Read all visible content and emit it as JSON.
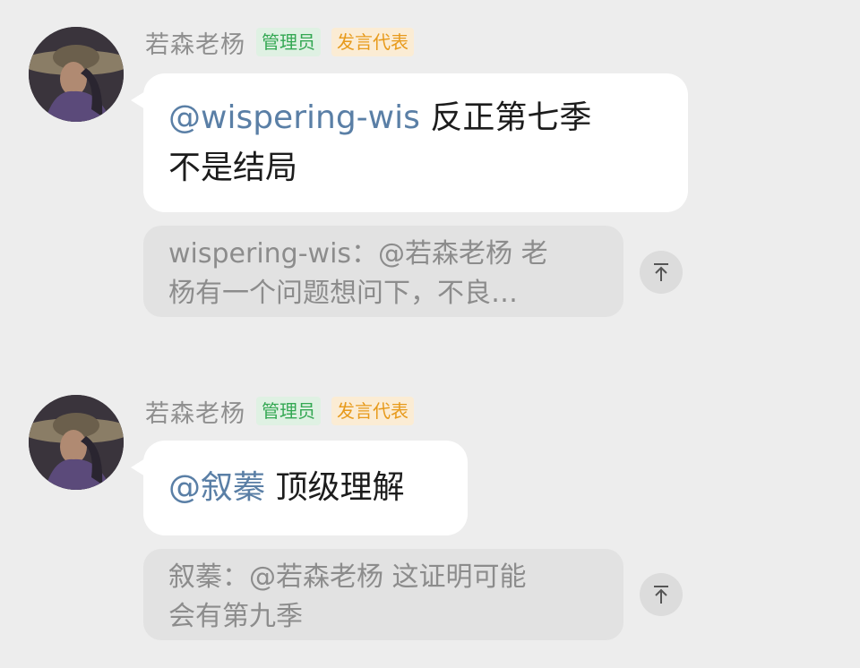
{
  "messages": [
    {
      "sender": "若森老杨",
      "badges": [
        "管理员",
        "发言代表"
      ],
      "mention": "@wispering-wis",
      "text_line1": " 反正第七季",
      "text_line2": "不是结局",
      "quote_line1": "wispering-wis：@若森老杨 老",
      "quote_line2": "杨有一个问题想问下，不良…"
    },
    {
      "sender": "若森老杨",
      "badges": [
        "管理员",
        "发言代表"
      ],
      "mention": "@叙蓁",
      "text_line1": " 顶级理解",
      "quote_line1": "叙蓁：@若森老杨 这证明可能",
      "quote_line2": "会有第九季"
    }
  ],
  "icons": {
    "avatar": "avatar-portrait",
    "jump": "arrow-up-to-top-icon"
  }
}
